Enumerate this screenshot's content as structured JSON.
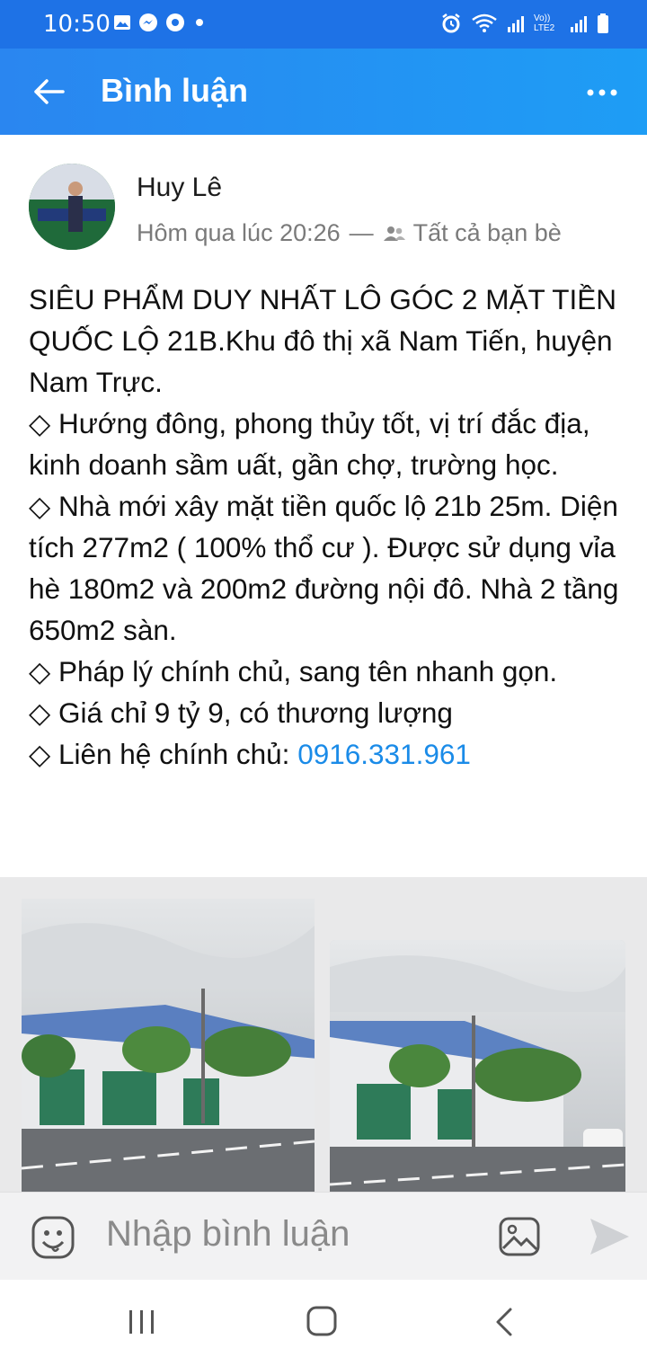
{
  "status_bar": {
    "time": "10:50",
    "network_label": "Vo)) LTE2"
  },
  "app_bar": {
    "title": "Bình luận"
  },
  "post": {
    "author": "Huy Lê",
    "timestamp": "Hôm qua lúc 20:26",
    "separator": "—",
    "audience": "Tất cả bạn bè",
    "lines": [
      "SIÊU PHẨM DUY NHẤT LÔ GÓC 2 MẶT TIỀN QUỐC LỘ 21B.Khu đô thị xã Nam Tiến, huyện Nam Trực.",
      "◇ Hướng đông, phong thủy tốt, vị trí đắc địa, kinh doanh sầm uất, gần chợ, trường học.",
      "◇ Nhà mới xây mặt tiền quốc lộ 21b 25m. Diện tích 277m2 ( 100% thổ cư ). Được sử dụng vỉa hè 180m2 và 200m2 đường nội đô. Nhà 2 tầng 650m2 sàn.",
      "◇ Pháp lý chính chủ, sang tên nhanh gọn.",
      "◇ Giá chỉ 9 tỷ 9, có thương lượng"
    ],
    "contact_prefix": "◇ Liên hệ chính chủ: ",
    "contact_phone": "0916.331.961",
    "photo_count": 2
  },
  "composer": {
    "placeholder": "Nhập bình luận"
  },
  "icons": {
    "status_left": [
      "gallery-icon",
      "messenger-icon",
      "vpn-icon",
      "dot-icon"
    ],
    "status_right": [
      "alarm-icon",
      "wifi-icon",
      "signal-icon",
      "battery-icon"
    ],
    "app_bar": [
      "back-arrow-icon",
      "more-icon"
    ],
    "composer": [
      "emoji-icon",
      "image-icon",
      "send-icon"
    ],
    "nav": [
      "recent-apps-icon",
      "home-icon",
      "back-icon"
    ]
  },
  "colors": {
    "app_bar": "#1e72e6",
    "link": "#1a8be8",
    "meta_text": "#7a7a7a"
  }
}
